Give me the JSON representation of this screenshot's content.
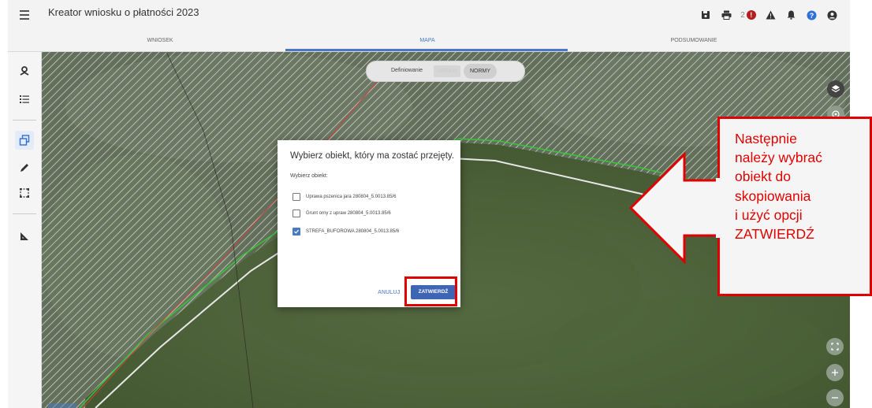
{
  "app": {
    "title": "Kreator wniosku o płatności 2023"
  },
  "header": {
    "alert_count": "2",
    "alert_mark": "!"
  },
  "tabs": [
    {
      "label": "WNIOSEK"
    },
    {
      "label": "MAPA"
    },
    {
      "label": "PODSUMOWANIE"
    }
  ],
  "mode_switch": {
    "label": "Definiowanie",
    "options": [
      "UPRAW",
      "NORMY"
    ]
  },
  "dialog": {
    "title": "Wybierz obiekt, który ma zostać przejęty.",
    "subtitle": "Wybierz obiekt:",
    "options": [
      {
        "label": "Uprawa pszenica jara 280804_5.0013.85/6",
        "checked": false
      },
      {
        "label": "Grunt orny z upraw 280804_5.0013.85/6",
        "checked": false
      },
      {
        "label": "STREFA_BUFOROWA 280804_5.0013.85/6",
        "checked": true
      }
    ],
    "cancel_label": "ANULUJ",
    "confirm_label": "ZATWIERDŹ"
  },
  "callout": {
    "lines": [
      "Następnie",
      "należy wybrać",
      "obiekt do",
      "skopiowania",
      "i użyć opcji",
      "ZATWIERDŹ"
    ]
  },
  "colors": {
    "accent": "#4a78c2",
    "annotation": "#e00000",
    "parcel_line": "#38c538",
    "road": "#e8e8e8",
    "boundary": "#d04040"
  }
}
